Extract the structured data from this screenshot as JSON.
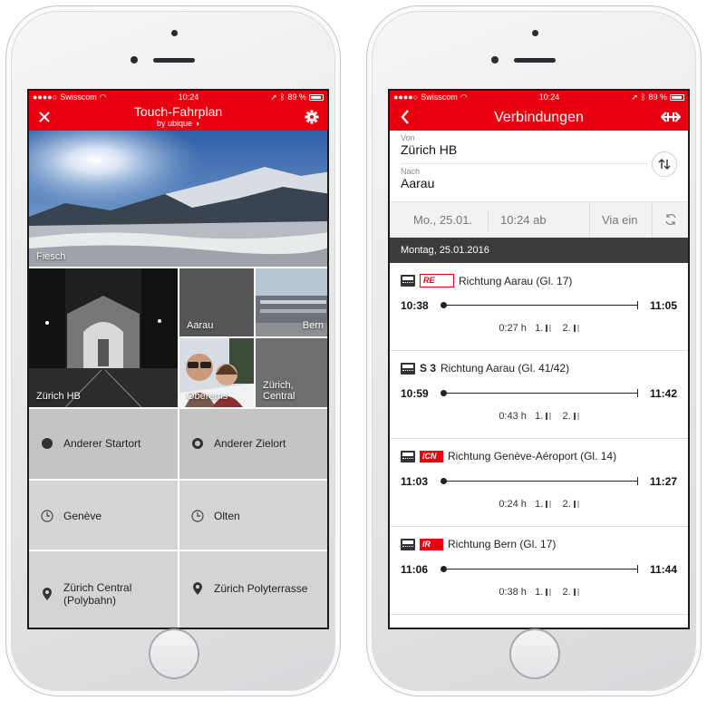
{
  "status": {
    "carrier": "Swisscom",
    "time": "10:24",
    "battery": "89 %"
  },
  "left": {
    "title": "Touch-Fahrplan",
    "subtitle": "by ubique",
    "tiles": [
      {
        "label": "Fiesch"
      },
      {
        "label": "Zürich HB"
      },
      {
        "label": "Aarau"
      },
      {
        "label": "Bern"
      },
      {
        "label": "Oberems"
      },
      {
        "label": "Zürich,\nCentral"
      }
    ],
    "actions": [
      {
        "label": "Anderer Startort",
        "icon": "filled-circle-icon"
      },
      {
        "label": "Anderer Zielort",
        "icon": "ring-icon"
      },
      {
        "label": "Genève",
        "icon": "history-icon"
      },
      {
        "label": "Olten",
        "icon": "history-icon"
      },
      {
        "label": "Zürich Central\n(Polybahn)",
        "icon": "location-pin-icon"
      },
      {
        "label": "Zürich Polyterrasse",
        "icon": "location-pin-icon"
      }
    ]
  },
  "right": {
    "title": "Verbindungen",
    "from_label": "Von",
    "from_value": "Zürich HB",
    "to_label": "Nach",
    "to_value": "Aarau",
    "date": "Mo., 25.01.",
    "time": "10:24 ab",
    "via": "Via ein",
    "day_header": "Montag, 25.01.2016",
    "connections": [
      {
        "badge": "RE",
        "badge_style": "re",
        "direction": "Richtung Aarau (Gl. 17)",
        "dep": "10:38",
        "arr": "11:05",
        "duration": "0:27 h",
        "class1": "1.",
        "class2": "2."
      },
      {
        "badge": "S 3",
        "badge_style": "s",
        "direction": "Richtung Aarau (Gl. 41/42)",
        "dep": "10:59",
        "arr": "11:42",
        "duration": "0:43 h",
        "class1": "1.",
        "class2": "2."
      },
      {
        "badge": "ICN",
        "badge_style": "red",
        "direction": "Richtung Genève-Aéroport (Gl. 14)",
        "dep": "11:03",
        "arr": "11:27",
        "duration": "0:24 h",
        "class1": "1.",
        "class2": "2."
      },
      {
        "badge": "IR",
        "badge_style": "red",
        "direction": "Richtung Bern (Gl. 17)",
        "dep": "11:06",
        "arr": "11:44",
        "duration": "0:38 h",
        "class1": "1.",
        "class2": "2."
      }
    ]
  },
  "colors": {
    "brand_red": "#e8000f",
    "header_dark": "#3c3c3c",
    "action_grey": "#d4d4d4"
  }
}
